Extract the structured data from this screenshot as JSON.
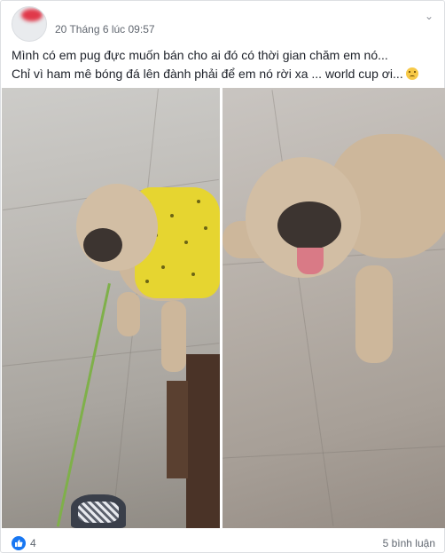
{
  "post": {
    "timestamp": "20 Tháng 6 lúc 09:57",
    "text_lines": [
      "Mình có em pug đực muốn bán cho ai đó có thời gian chăm em nó...",
      "Chỉ vì ham mê bóng đá lên đành phải để em nó rời xa ... world cup ơi..."
    ],
    "emoji": "worried-face-emoji",
    "photos": [
      {
        "subject": "pug-in-yellow-polka-dot-vest"
      },
      {
        "subject": "pug-lying-with-tongue-out"
      }
    ]
  },
  "footer": {
    "reaction_icon": "like-icon",
    "reaction_color": "#1877f2",
    "like_count": "4",
    "comment_count": "5 bình luận"
  },
  "colors": {
    "text": "#1d2129",
    "meta": "#616770",
    "border": "#dddfe2"
  }
}
